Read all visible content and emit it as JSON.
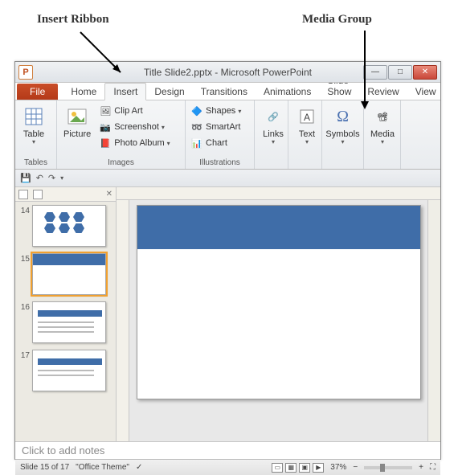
{
  "annotations": {
    "insert_ribbon": "Insert Ribbon",
    "media_group": "Media Group"
  },
  "title": "Title Slide2.pptx - Microsoft PowerPoint",
  "app_letter": "P",
  "tabs": {
    "file": "File",
    "home": "Home",
    "insert": "Insert",
    "design": "Design",
    "transitions": "Transitions",
    "animations": "Animations",
    "slideshow": "Slide Show",
    "review": "Review",
    "view": "View"
  },
  "groups": {
    "tables": {
      "label": "Tables",
      "table": "Table"
    },
    "images": {
      "label": "Images",
      "picture": "Picture",
      "clipart": "Clip Art",
      "screenshot": "Screenshot",
      "photoalbum": "Photo Album"
    },
    "illustrations": {
      "label": "Illustrations",
      "shapes": "Shapes",
      "smartart": "SmartArt",
      "chart": "Chart"
    },
    "links": {
      "label": "Links",
      "links_btn": "Links"
    },
    "text": {
      "label": "Text",
      "text_btn": "Text"
    },
    "symbols": {
      "label": "Symbols",
      "symbols_btn": "Symbols"
    },
    "media": {
      "label": "Media",
      "media_btn": "Media"
    }
  },
  "thumbs": [
    "14",
    "15",
    "16",
    "17"
  ],
  "notes_placeholder": "Click to add notes",
  "status": {
    "slide": "Slide 15 of 17",
    "theme": "\"Office Theme\"",
    "zoom": "37%"
  }
}
